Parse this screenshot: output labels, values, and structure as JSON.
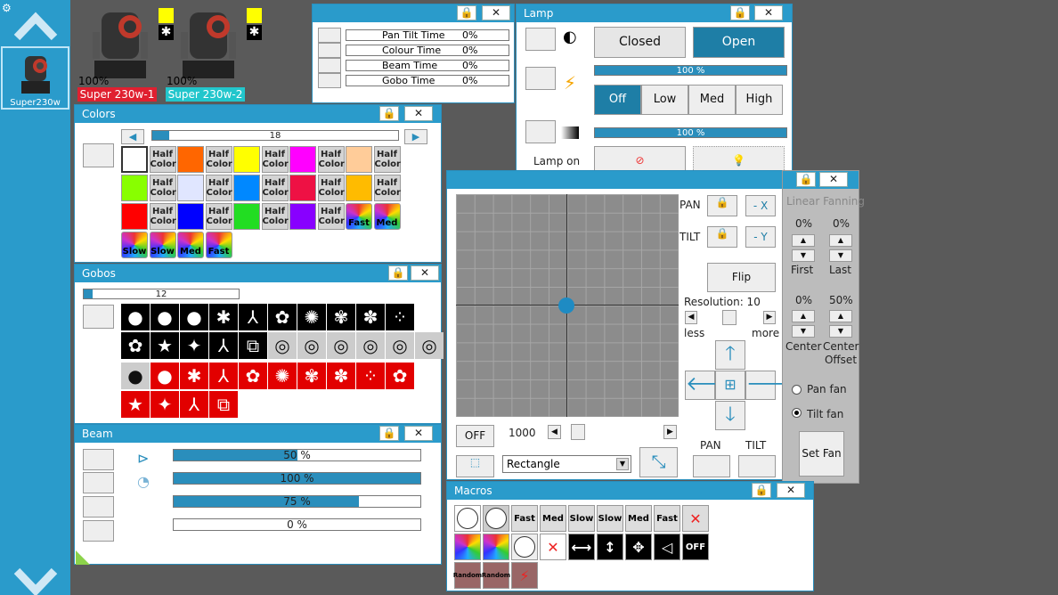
{
  "fixtures": [
    {
      "name": "Super 230w-1",
      "percent": "100%",
      "color": "#e02030"
    },
    {
      "name": "Super 230w-2",
      "percent": "100%",
      "color": "#22c6cc"
    }
  ],
  "sidebar": {
    "item": "Super230w"
  },
  "times": {
    "rows": [
      {
        "label": "Pan Tilt Time",
        "value": "0%"
      },
      {
        "label": "Colour Time",
        "value": "0%"
      },
      {
        "label": "Beam Time",
        "value": "0%"
      },
      {
        "label": "Gobo Time",
        "value": "0%"
      }
    ]
  },
  "lamp": {
    "title": "Lamp",
    "closed": "Closed",
    "open": "Open",
    "bar1": "100 %",
    "off": "Off",
    "low": "Low",
    "med": "Med",
    "high": "High",
    "bar2": "100 %",
    "lamp_on": "Lamp on"
  },
  "colors": {
    "title": "Colors",
    "page": "18",
    "half": "Half",
    "color_word": "Color",
    "slow": "Slow",
    "med": "Med",
    "fast": "Fast"
  },
  "gobos": {
    "title": "Gobos",
    "page": "12"
  },
  "beam": {
    "title": "Beam",
    "bars": [
      {
        "text": "50 %",
        "value": 50
      },
      {
        "text": "100 %",
        "value": 100
      },
      {
        "text": "75 %",
        "value": 75
      },
      {
        "text": "0 %",
        "value": 0
      }
    ]
  },
  "pantilt": {
    "pan": "PAN",
    "tilt": "TILT",
    "neg_x": "- X",
    "neg_y": "- Y",
    "flip": "Flip",
    "resolution": "Resolution: 10",
    "less": "less",
    "more": "more",
    "off": "OFF",
    "speed": "1000",
    "shape": "Rectangle",
    "pan2": "PAN",
    "tilt2": "TILT"
  },
  "fanning": {
    "title": "Linear Fanning",
    "first_val": "0%",
    "last_val": "0%",
    "first": "First",
    "last": "Last",
    "center_val": "0%",
    "offset_val": "50%",
    "center": "Center",
    "offset": "Center Offset",
    "pan_fan": "Pan fan",
    "tilt_fan": "Tilt fan",
    "set_fan": "Set Fan"
  },
  "macros": {
    "title": "Macros",
    "fast": "Fast",
    "med": "Med",
    "slow": "Slow",
    "off": "OFF",
    "random": "Random"
  }
}
